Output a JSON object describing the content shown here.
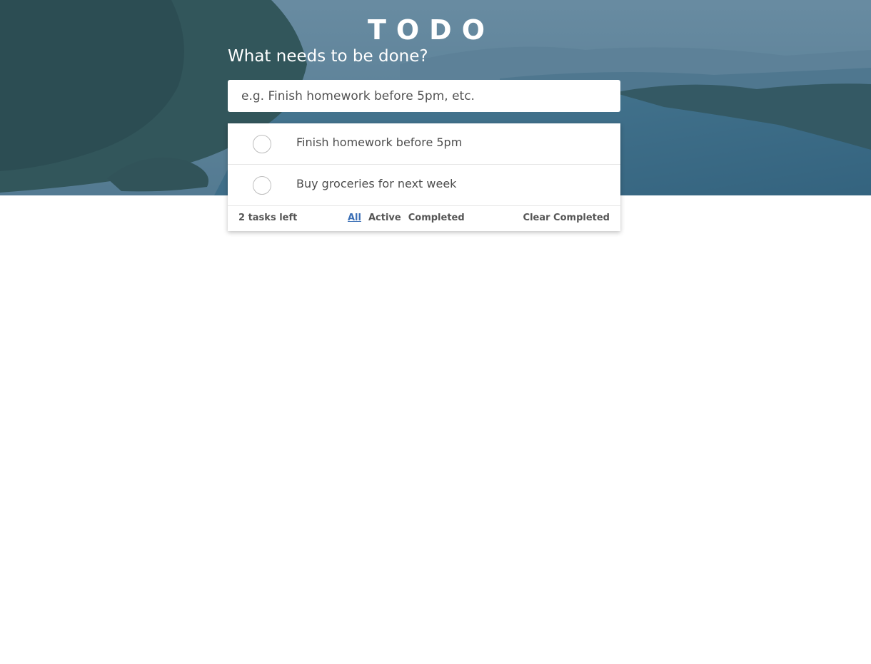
{
  "app": {
    "title": "TODO",
    "prompt": "What needs to be done?"
  },
  "new_todo": {
    "value": "",
    "placeholder": "e.g. Finish homework before 5pm, etc."
  },
  "todos": [
    {
      "label": "Finish homework before 5pm",
      "completed": false
    },
    {
      "label": "Buy groceries for next week",
      "completed": false
    }
  ],
  "footer": {
    "count_text": "2 tasks left",
    "filters": [
      "All",
      "Active",
      "Completed"
    ],
    "selected_filter": "All",
    "clear_label": "Clear Completed"
  },
  "colors": {
    "hero_overlay": "#3f6e86",
    "link_blue": "#3b6fb6",
    "text_gray": "#4d4d4d"
  }
}
